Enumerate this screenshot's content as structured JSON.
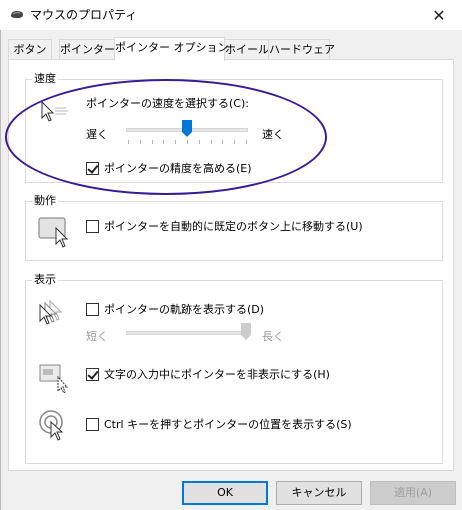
{
  "window": {
    "title": "マウスのプロパティ",
    "close_glyph": "✕"
  },
  "tabs": [
    {
      "label": "ボタン"
    },
    {
      "label": "ポインター"
    },
    {
      "label": "ポインター オプション"
    },
    {
      "label": "ホイール"
    },
    {
      "label": "ハードウェア"
    }
  ],
  "active_tab": "ポインター オプション",
  "speed": {
    "group_title": "速度",
    "select_label": "ポインターの速度を選択する(C):",
    "slow_label": "遅く",
    "fast_label": "速く",
    "slider_level": 0.5,
    "tick_count": 11,
    "precision_label": "ポインターの精度を高める(E)",
    "precision_checked": true
  },
  "motion": {
    "group_title": "動作",
    "snap_label": "ポインターを自動的に既定のボタン上に移動する(U)",
    "snap_checked": false
  },
  "visibility": {
    "group_title": "表示",
    "trails_label": "ポインターの軌跡を表示する(D)",
    "trails_checked": false,
    "trails_short": "短く",
    "trails_long": "長く",
    "trails_level": 1.0,
    "hide_label": "文字の入力中にポインターを非表示にする(H)",
    "hide_checked": true,
    "ctrl_label": "Ctrl キーを押すとポインターの位置を表示する(S)",
    "ctrl_checked": false
  },
  "buttons": {
    "ok": "OK",
    "cancel": "キャンセル",
    "apply": "適用(A)"
  },
  "colors": {
    "accent": "#0078d7",
    "annotation": "#3a1c95",
    "thumb": "#0078d7"
  }
}
